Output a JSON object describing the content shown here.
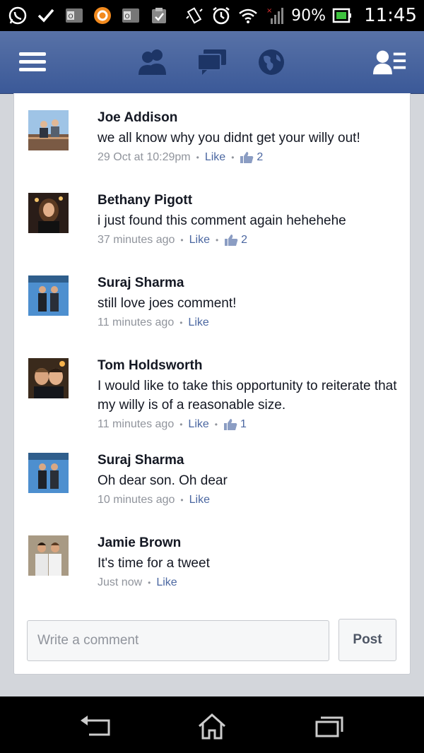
{
  "status_bar": {
    "battery": "90%",
    "time": "11:45",
    "left_icons": [
      "whatsapp-icon",
      "check-icon",
      "outlook-icon",
      "orange-app-icon",
      "outlook-icon",
      "clipboard-icon"
    ],
    "right_icons": [
      "vibrate-icon",
      "alarm-icon",
      "wifi-icon",
      "signal-icon",
      "battery-icon"
    ]
  },
  "navbar": {
    "icons": [
      "menu-icon",
      "friend-requests-icon",
      "messages-icon",
      "notifications-globe-icon",
      "friends-list-icon"
    ],
    "brand_color": "#3b5998"
  },
  "comments": [
    {
      "name": "Joe Addison",
      "text": "we all know why you didnt get your willy out!",
      "time": "29 Oct at 10:29pm",
      "like": "Like",
      "likes": "2"
    },
    {
      "name": "Bethany Pigott",
      "text": "i just found this comment again hehehehe",
      "time": "37 minutes ago",
      "like": "Like",
      "likes": "2"
    },
    {
      "name": "Suraj Sharma",
      "text": "still love joes comment!",
      "time": "11 minutes ago",
      "like": "Like"
    },
    {
      "name": "Tom Holdsworth",
      "text": "I would like to take this opportunity to reiterate that my willy is of a reasonable size.",
      "time": "11 minutes ago",
      "like": "Like",
      "likes": "1"
    },
    {
      "name": "Suraj Sharma",
      "text": "Oh dear son. Oh dear",
      "time": "10 minutes ago",
      "like": "Like"
    },
    {
      "name": "Jamie Brown",
      "text": "It's time for a tweet",
      "time": "Just now",
      "like": "Like"
    }
  ],
  "composer": {
    "placeholder": "Write a comment",
    "value": "",
    "post_label": "Post"
  },
  "bottom_nav": {
    "icons": [
      "back-icon",
      "home-icon",
      "recent-apps-icon"
    ]
  }
}
